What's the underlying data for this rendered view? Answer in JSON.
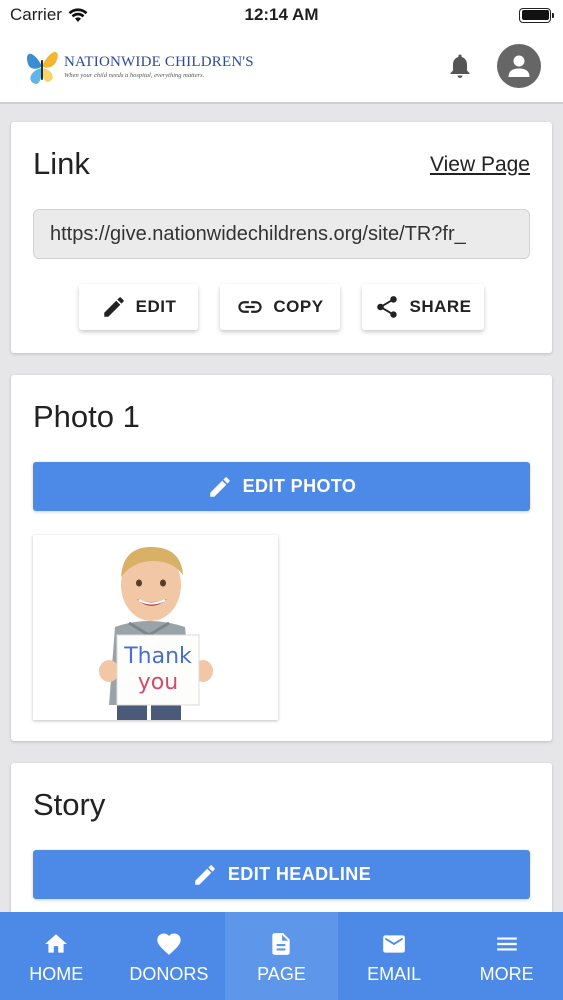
{
  "status_bar": {
    "carrier": "Carrier",
    "time": "12:14 AM"
  },
  "header": {
    "logo_name": "NATIONWIDE CHILDREN'S",
    "logo_tagline": "When your child needs a hospital, everything matters."
  },
  "link_card": {
    "title": "Link",
    "view_page": "View Page",
    "url": "https://give.nationwidechildrens.org/site/TR?fr_",
    "buttons": {
      "edit": "EDIT",
      "copy": "COPY",
      "share": "SHARE"
    }
  },
  "photo_card": {
    "title": "Photo 1",
    "edit_photo": "EDIT PHOTO",
    "sign_line1": "Thank",
    "sign_line2": "you"
  },
  "story_card": {
    "title": "Story",
    "edit_headline": "EDIT HEADLINE"
  },
  "tab_bar": {
    "active": "PAGE",
    "tabs": [
      {
        "label": "HOME",
        "icon": "home-icon"
      },
      {
        "label": "DONORS",
        "icon": "heart-icon"
      },
      {
        "label": "PAGE",
        "icon": "page-icon"
      },
      {
        "label": "EMAIL",
        "icon": "email-icon"
      },
      {
        "label": "MORE",
        "icon": "menu-icon"
      }
    ]
  },
  "colors": {
    "accent": "#4d8ae8",
    "brand_blue": "#2b4a9a",
    "background": "#e6e6e8"
  }
}
